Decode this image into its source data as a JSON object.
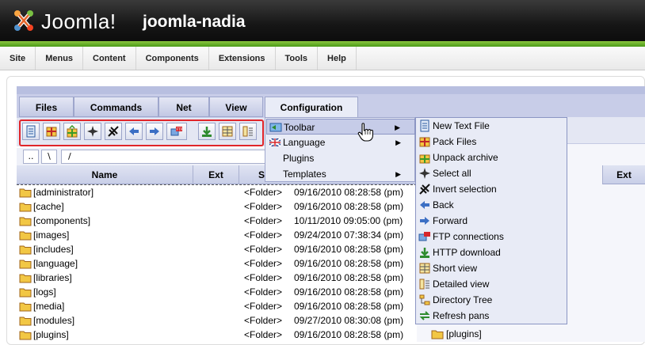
{
  "header": {
    "brand": "Joomla!",
    "site_name": "joomla-nadia",
    "logo_icon": "joomla-logo-icon"
  },
  "admin_menu": [
    "Site",
    "Menus",
    "Content",
    "Components",
    "Extensions",
    "Tools",
    "Help"
  ],
  "tabs": [
    "Files",
    "Commands",
    "Net",
    "View",
    "Configuration"
  ],
  "active_tab": "Configuration",
  "toolbar_icons": [
    "new-text-file-icon",
    "pack-files-icon",
    "unpack-archive-icon",
    "select-all-icon",
    "invert-selection-icon",
    "back-icon",
    "forward-icon",
    "ftp-connections-icon",
    "http-download-icon",
    "short-view-icon",
    "detailed-view-icon"
  ],
  "path_bar": {
    "up": "..",
    "root": "\\",
    "path": "/"
  },
  "columns": {
    "name": "Name",
    "ext": "Ext",
    "size_partial": "S",
    "right_ext": "Ext"
  },
  "rows": [
    {
      "name": "[administrator]",
      "type": "<Folder>",
      "date": "09/16/2010 08:28:58 (pm)"
    },
    {
      "name": "[cache]",
      "type": "<Folder>",
      "date": "09/16/2010 08:28:58 (pm)"
    },
    {
      "name": "[components]",
      "type": "<Folder>",
      "date": "10/11/2010 09:05:00 (pm)"
    },
    {
      "name": "[images]",
      "type": "<Folder>",
      "date": "09/24/2010 07:38:34 (pm)"
    },
    {
      "name": "[includes]",
      "type": "<Folder>",
      "date": "09/16/2010 08:28:58 (pm)"
    },
    {
      "name": "[language]",
      "type": "<Folder>",
      "date": "09/16/2010 08:28:58 (pm)"
    },
    {
      "name": "[libraries]",
      "type": "<Folder>",
      "date": "09/16/2010 08:28:58 (pm)"
    },
    {
      "name": "[logs]",
      "type": "<Folder>",
      "date": "09/16/2010 08:28:58 (pm)"
    },
    {
      "name": "[media]",
      "type": "<Folder>",
      "date": "09/16/2010 08:28:58 (pm)"
    },
    {
      "name": "[modules]",
      "type": "<Folder>",
      "date": "09/27/2010 08:30:08 (pm)"
    },
    {
      "name": "[plugins]",
      "type": "<Folder>",
      "date": "09/16/2010 08:28:58 (pm)"
    }
  ],
  "right_panel_row": "[plugins]",
  "config_menu": [
    {
      "label": "Toolbar",
      "icon": "toolbar-icon",
      "submenu": true
    },
    {
      "label": "Language",
      "icon": "uk-flag-icon",
      "submenu": true
    },
    {
      "label": "Plugins",
      "icon": "",
      "submenu": false
    },
    {
      "label": "Templates",
      "icon": "",
      "submenu": true
    }
  ],
  "toolbar_submenu": [
    {
      "label": "New Text File",
      "icon": "new-text-file-icon"
    },
    {
      "label": "Pack Files",
      "icon": "pack-files-icon"
    },
    {
      "label": "Unpack archive",
      "icon": "unpack-archive-icon"
    },
    {
      "label": "Select all",
      "icon": "select-all-icon"
    },
    {
      "label": "Invert selection",
      "icon": "invert-selection-icon"
    },
    {
      "label": "Back",
      "icon": "back-icon"
    },
    {
      "label": "Forward",
      "icon": "forward-icon"
    },
    {
      "label": "FTP connections",
      "icon": "ftp-connections-icon"
    },
    {
      "label": "HTTP download",
      "icon": "http-download-icon"
    },
    {
      "label": "Short view",
      "icon": "short-view-icon"
    },
    {
      "label": "Detailed view",
      "icon": "detailed-view-icon"
    },
    {
      "label": "Directory Tree",
      "icon": "directory-tree-icon"
    },
    {
      "label": "Refresh pans",
      "icon": "refresh-pans-icon"
    }
  ],
  "colors": {
    "header_dark": "#161616",
    "header_green": "#6bb02a",
    "tab_bar": "#c8cde8",
    "toolbar_highlight_frame": "#e0252a",
    "folder_yellow": "#f2c744"
  }
}
